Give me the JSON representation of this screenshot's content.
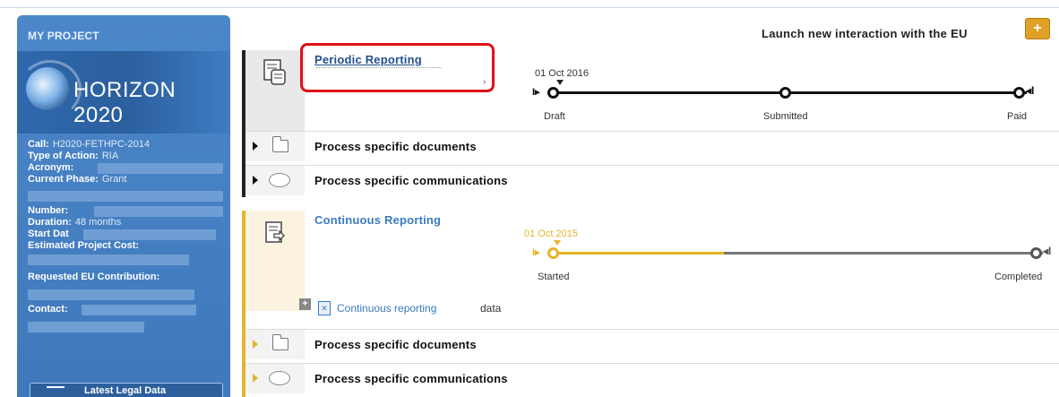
{
  "sidebar": {
    "title": "MY PROJECT",
    "program": "HORIZON 2020",
    "fields": [
      {
        "key": "Call:",
        "value": "H2020-FETHPC-2014"
      },
      {
        "key": "Type of Action:",
        "value": "RIA"
      },
      {
        "key": "Acronym:",
        "value": ""
      },
      {
        "key": "Current Phase:",
        "value": "Grant"
      },
      {
        "key": "Number:",
        "value": ""
      },
      {
        "key": "Duration:",
        "value": "48 months"
      },
      {
        "key": "Start Dat",
        "value": ""
      },
      {
        "key": "Estimated Project Cost:",
        "value": ""
      },
      {
        "key": "Requested EU Contribution:",
        "value": ""
      },
      {
        "key": "Contact:",
        "value": ""
      }
    ],
    "legal_button": "Latest Legal Data"
  },
  "header": {
    "launch_label": "Launch new interaction with the EU",
    "plus_label": "+"
  },
  "processes": [
    {
      "title": "Periodic Reporting",
      "date": "01 Oct 2016",
      "steps": [
        "Draft",
        "Submitted",
        "Paid"
      ],
      "progress": 0,
      "color": "#111111"
    },
    {
      "title": "Continuous Reporting",
      "date": "01 Oct 2015",
      "steps": [
        "Started",
        "Completed"
      ],
      "progress": 0.35,
      "color": "#e3b52b"
    }
  ],
  "sections": {
    "documents": "Process specific documents",
    "communications": "Process specific communications"
  },
  "continuous_data": {
    "link": "Continuous reporting",
    "text": "data"
  },
  "colors": {
    "sidebar_blue": "#4c87c9",
    "highlight_red": "#e0101a",
    "accent_orange": "#e0a226",
    "continuous_yellow": "#e3b52b",
    "link_blue": "#3a7bc1"
  }
}
